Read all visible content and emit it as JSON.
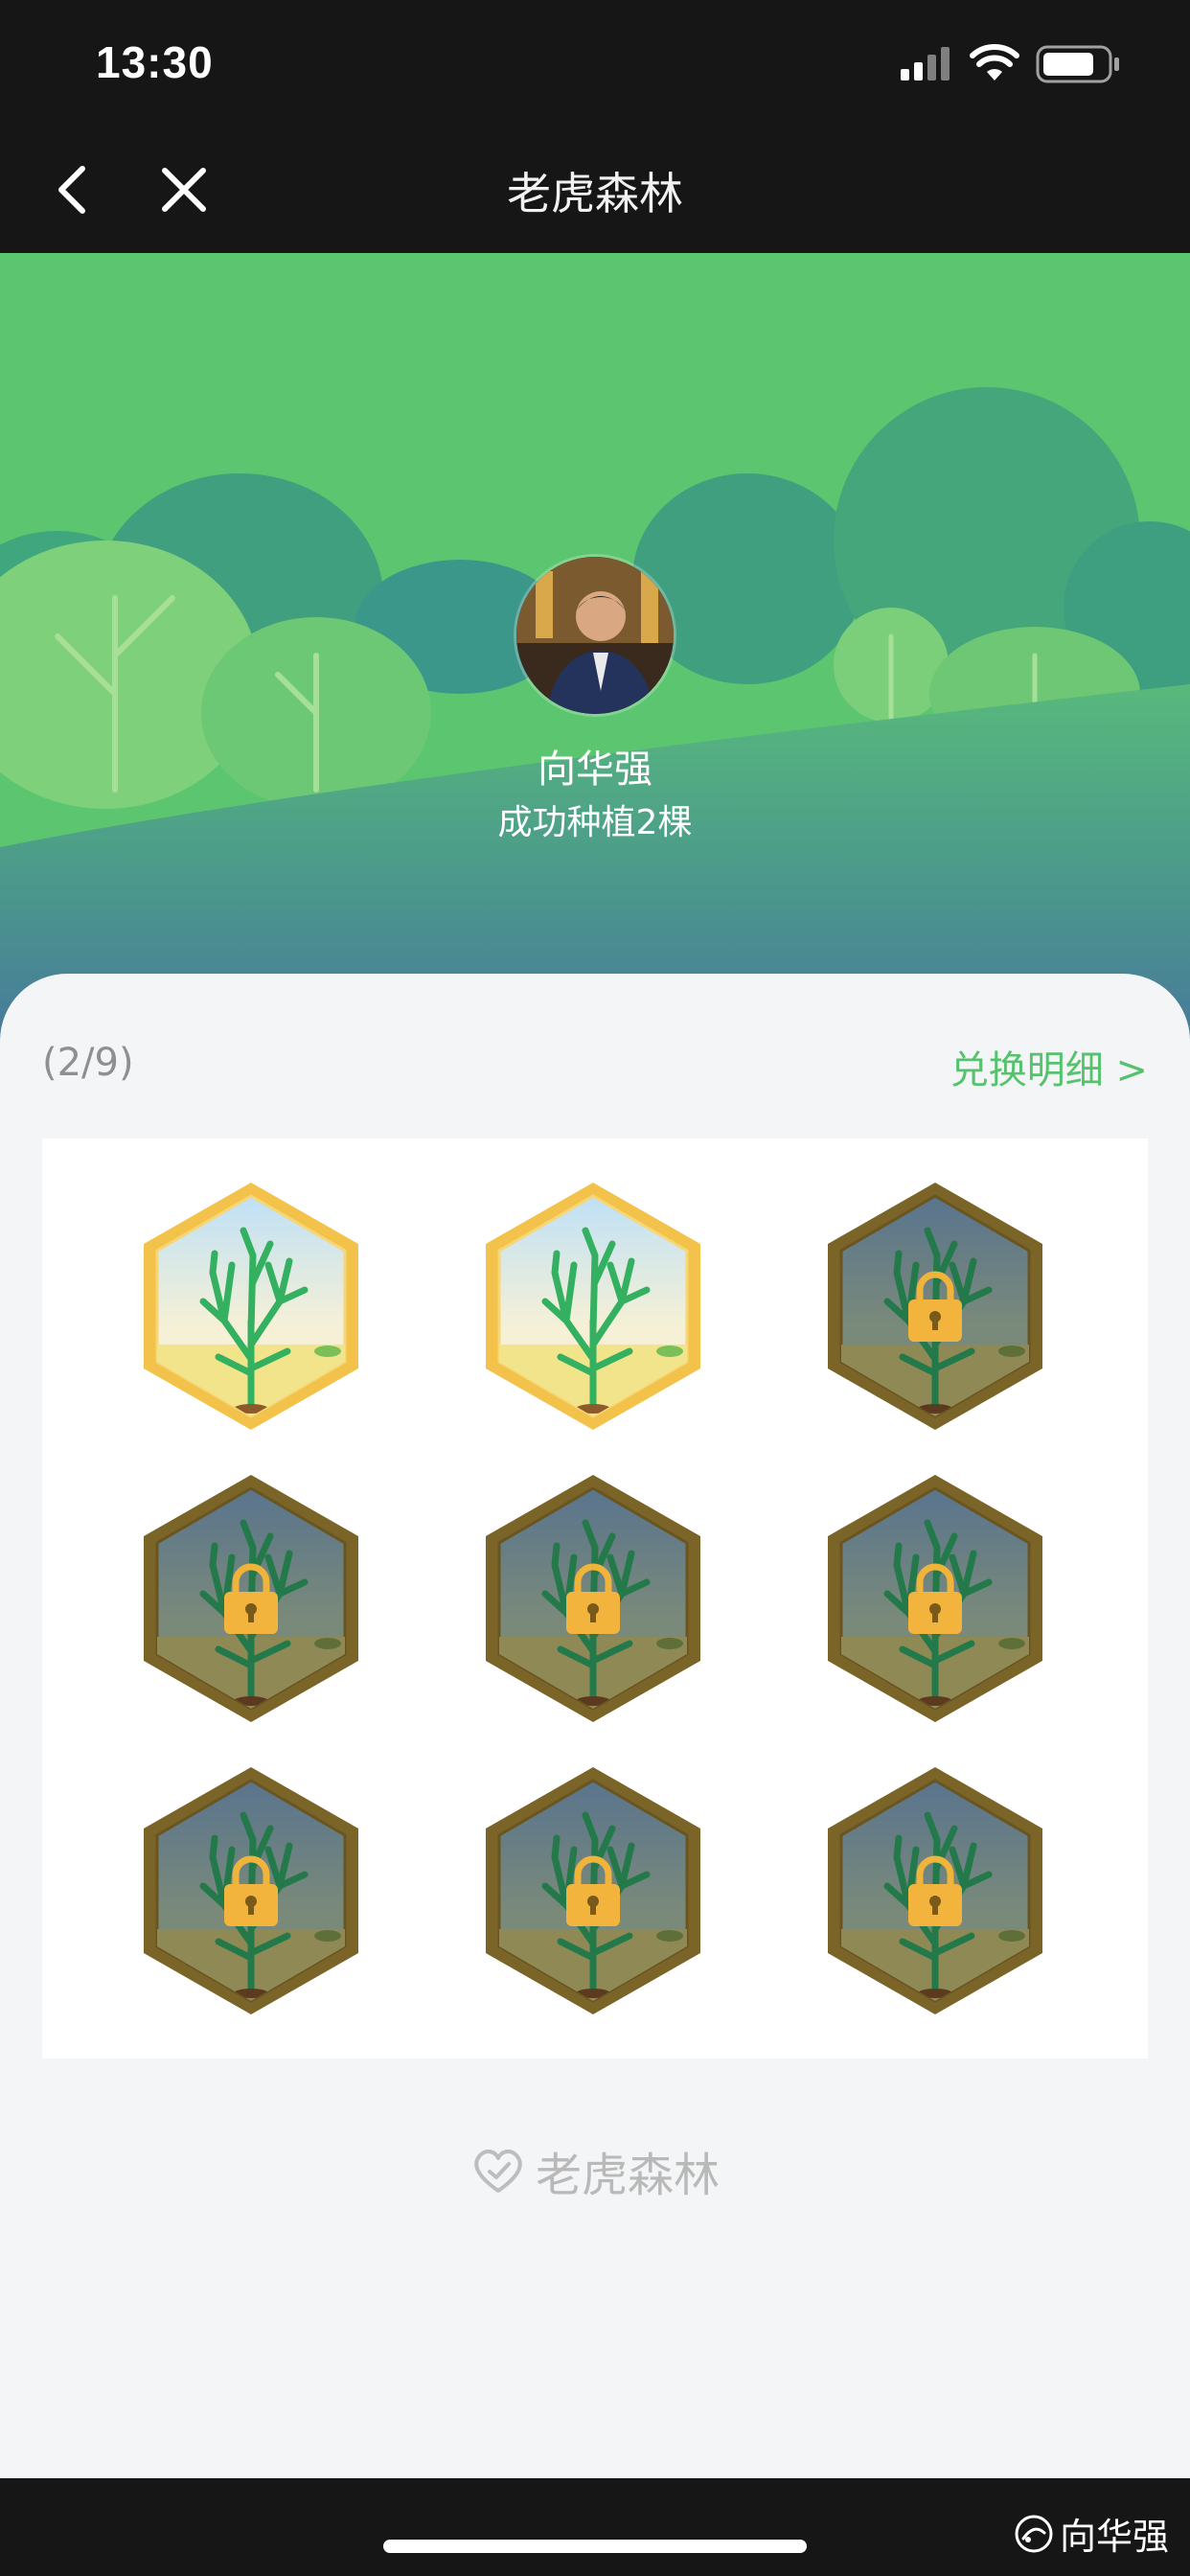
{
  "status_bar": {
    "time": "13:30"
  },
  "nav": {
    "title": "老虎森林",
    "back_icon": "chevron-left-icon",
    "close_icon": "close-icon"
  },
  "profile": {
    "name": "向华强",
    "subtitle": "成功种植2棵"
  },
  "progress": {
    "text": "(2/9)",
    "unlocked": 2,
    "total": 9
  },
  "exchange": {
    "label": "兑换明细 >"
  },
  "badges": [
    {
      "state": "unlocked"
    },
    {
      "state": "unlocked"
    },
    {
      "state": "locked"
    },
    {
      "state": "locked"
    },
    {
      "state": "locked"
    },
    {
      "state": "locked"
    },
    {
      "state": "locked"
    },
    {
      "state": "locked"
    },
    {
      "state": "locked"
    }
  ],
  "footer": {
    "brand": "老虎森林"
  },
  "watermark": {
    "text": "向华强"
  },
  "colors": {
    "accent_green": "#56c26e",
    "hero_green": "#5bc56f",
    "badge_gold": "#f3c24a",
    "badge_locked_frame": "#7b6428",
    "dark_bar": "#161616"
  }
}
